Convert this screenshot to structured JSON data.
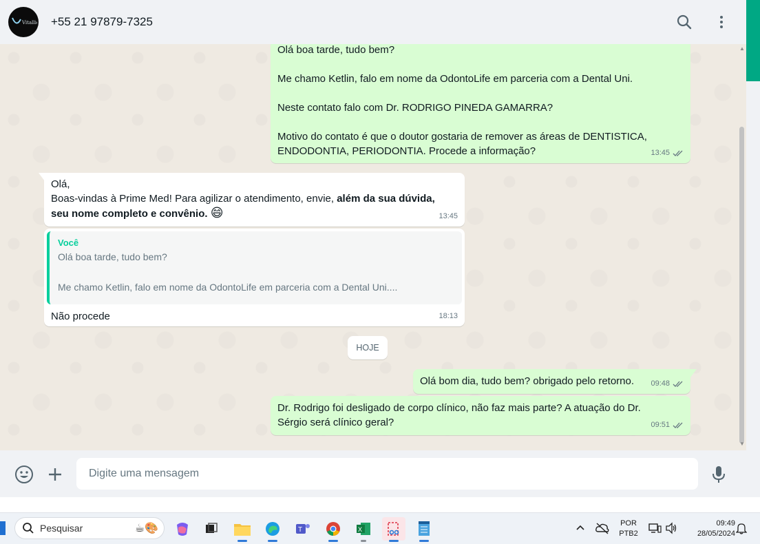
{
  "header": {
    "contact": "+55 21 97879-7325",
    "avatar_logo_text": "Vitallie"
  },
  "messages": {
    "m1": {
      "lines": [
        "Olá boa tarde, tudo bem?",
        "",
        "Me chamo Ketlin, falo em nome da OdontoLife em parceria com a Dental Uni.",
        "",
        "Neste contato falo com Dr. RODRIGO PINEDA GAMARRA?",
        "",
        "Motivo do contato é que o doutor gostaria de remover as áreas de DENTISTICA,",
        "ENDODONTIA, PERIODONTIA. Procede a informação?"
      ],
      "time": "13:45"
    },
    "m2": {
      "line1": "Olá,",
      "line2_normal": "Boas-vindas à Prime Med! Para agilizar o atendimento, envie, ",
      "line2_bold": "além da sua dúvida,",
      "line3_bold": "seu nome completo e convênio.",
      "emoji": "😄",
      "time": "13:45"
    },
    "m3": {
      "quote_author": "Você",
      "quote_line1": "Olá boa tarde, tudo bem?",
      "quote_line2": "Me chamo Ketlin, falo em nome da OdontoLife em parceria com a Dental Uni....",
      "text": "Não procede",
      "time": "18:13"
    },
    "day_divider": "HOJE",
    "m4": {
      "text": "Olá bom dia, tudo bem? obrigado pelo retorno.",
      "time": "09:48"
    },
    "m5": {
      "line1": "Dr. Rodrigo foi desligado de corpo clínico, não faz mais parte? A atuação do Dr.",
      "line2": "Sérgio será clínico geral?",
      "time": "09:51"
    }
  },
  "composer": {
    "placeholder": "Digite uma mensagem"
  },
  "taskbar": {
    "search": "Pesquisar",
    "lang_top": "POR",
    "lang_bottom": "PTB2",
    "time": "09:49",
    "date": "28/05/2024"
  },
  "colors": {
    "outgoing_bubble": "#d9fdd3",
    "incoming_bubble": "#ffffff",
    "accent": "#00a884",
    "quote_accent": "#06cf9c",
    "tick": "#667781"
  }
}
